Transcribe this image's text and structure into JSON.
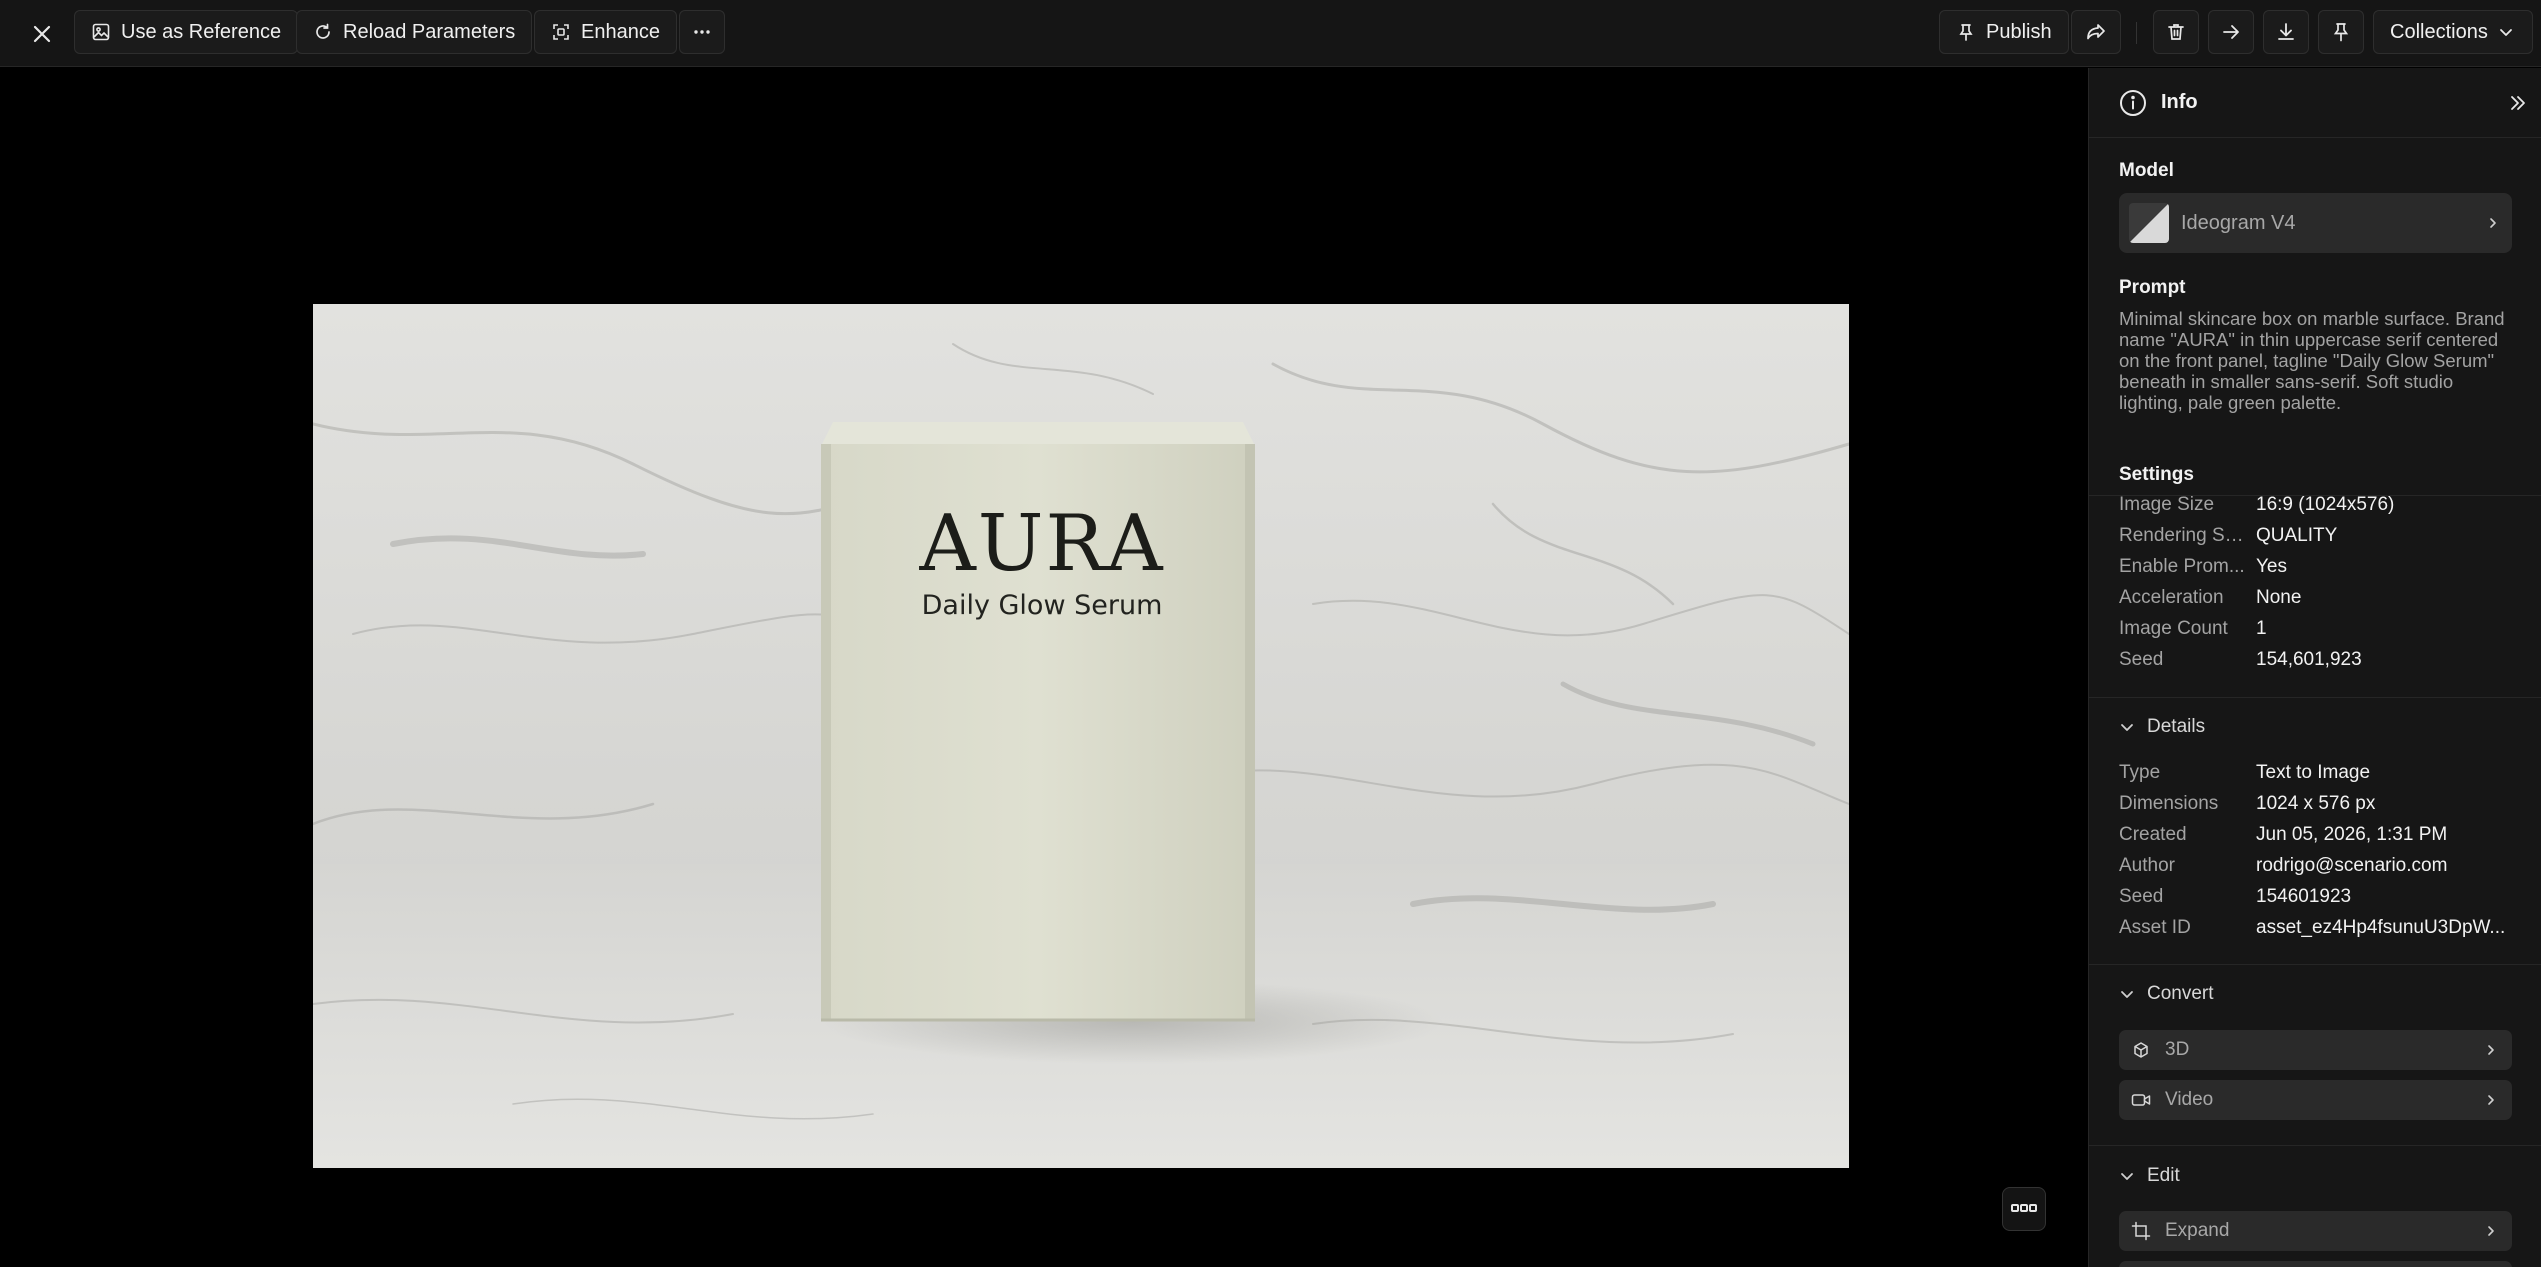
{
  "toolbar": {
    "use_as_reference": "Use as Reference",
    "reload_parameters": "Reload Parameters",
    "enhance": "Enhance",
    "publish": "Publish",
    "collections": "Collections"
  },
  "image": {
    "brand": "AURA",
    "tagline": "Daily Glow Serum"
  },
  "panel": {
    "title": "Info",
    "model_label": "Model",
    "model_name": "Ideogram V4",
    "prompt_label": "Prompt",
    "prompt": "Minimal skincare box on marble surface. Brand name \"AURA\" in thin uppercase serif centered on the front panel, tagline \"Daily Glow Serum\" beneath in smaller sans-serif. Soft studio lighting, pale green palette.",
    "settings_label": "Settings",
    "settings": [
      {
        "k": "Image Size",
        "v": "16:9 (1024x576)"
      },
      {
        "k": "Rendering Sp...",
        "v": "QUALITY"
      },
      {
        "k": "Enable Prom...",
        "v": "Yes"
      },
      {
        "k": "Acceleration",
        "v": "None"
      },
      {
        "k": "Image Count",
        "v": "1"
      },
      {
        "k": "Seed",
        "v": "154,601,923"
      }
    ],
    "details_label": "Details",
    "details": [
      {
        "k": "Type",
        "v": "Text to Image"
      },
      {
        "k": "Dimensions",
        "v": "1024 x 576 px"
      },
      {
        "k": "Created",
        "v": "Jun 05, 2026, 1:31 PM"
      },
      {
        "k": "Author",
        "v": "rodrigo@scenario.com"
      },
      {
        "k": "Seed",
        "v": "154601923"
      },
      {
        "k": "Asset ID",
        "v": "asset_ez4Hp4fsunuU3DpW..."
      }
    ],
    "convert_label": "Convert",
    "convert_3d": "3D",
    "convert_video": "Video",
    "edit_label": "Edit",
    "edit_expand": "Expand"
  }
}
